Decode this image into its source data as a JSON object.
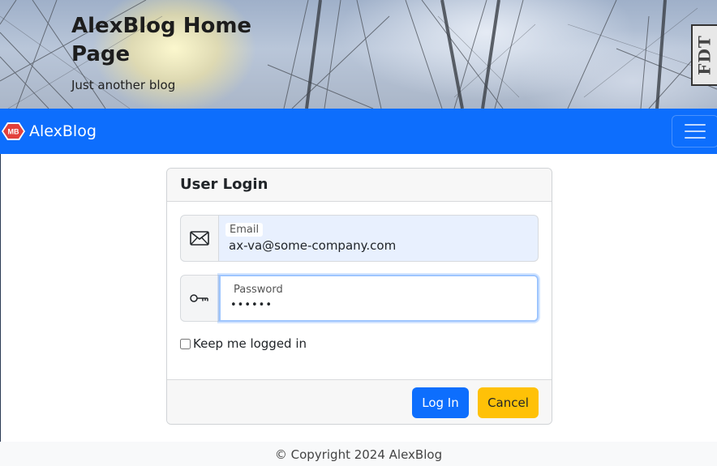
{
  "hero": {
    "title": "AlexBlog Home Page",
    "subtitle": "Just another blog",
    "badge_text": "FDT"
  },
  "navbar": {
    "brand_logo_text": "MB",
    "brand_name": "AlexBlog",
    "toggler_icon": "hamburger-menu-icon"
  },
  "login": {
    "title": "User Login",
    "email": {
      "icon": "envelope-icon",
      "label": "Email",
      "value": "ax-va@some-company.com"
    },
    "password": {
      "icon": "key-icon",
      "label": "Password",
      "value": "••••••"
    },
    "remember": {
      "label": "Keep me logged in",
      "checked": false
    },
    "login_button": "Log In",
    "cancel_button": "Cancel"
  },
  "footer": {
    "copyright": "© Copyright 2024 AlexBlog"
  },
  "colors": {
    "primary": "#0d6efd",
    "warning": "#ffc107",
    "logo_red": "#e2403b"
  }
}
